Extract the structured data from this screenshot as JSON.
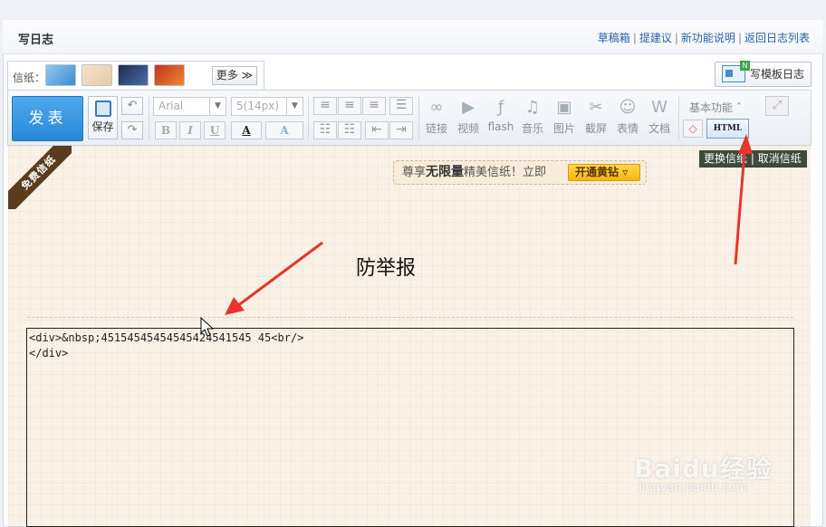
{
  "header": {
    "title": "写日志",
    "links": [
      "草稿箱",
      "提建议",
      "新功能说明",
      "返回日志列表"
    ],
    "separator": "|"
  },
  "stationery": {
    "label": "信纸：",
    "thumb_icons": [
      "lion-stationery-icon",
      "fairy-girl-stationery-icon",
      "boy-stationery-icon",
      "red-hair-girl-stationery-icon"
    ],
    "more_label": "更多",
    "more_chevron": "≫"
  },
  "template": {
    "label": "写模板日志"
  },
  "toolbar": {
    "publish_label": "发表",
    "save_label": "保存",
    "undo_glyph": "↶",
    "redo_glyph": "↷",
    "font_family": "Arial",
    "font_size": "5(14px)",
    "bold": "B",
    "italic": "I",
    "underline": "U",
    "font_color": "A",
    "highlight": "A",
    "media": [
      {
        "label": "链接",
        "glyph": "∞"
      },
      {
        "label": "视频",
        "glyph": "▶"
      },
      {
        "label": "flash",
        "glyph": "ƒ"
      },
      {
        "label": "音乐",
        "glyph": "♫"
      },
      {
        "label": "图片",
        "glyph": "▣"
      },
      {
        "label": "截屏",
        "glyph": "✂"
      },
      {
        "label": "表情",
        "glyph": "☺"
      },
      {
        "label": "文档",
        "glyph": "W"
      }
    ],
    "basic_label": "基本功能",
    "basic_chevron": "ˆ",
    "html_label": "HTML",
    "eraser_glyph": "◇",
    "expand_glyph": "⤢"
  },
  "editor": {
    "banner_text": "免费信纸",
    "change_stationery": "更换信纸",
    "cancel_stationery": "取消信纸",
    "change_sep": "|",
    "promo_prefix": "尊享",
    "promo_bold": "无限量",
    "promo_suffix": "精美信纸！立即",
    "promo_button": "开通黄钻",
    "annotation": "防举报",
    "code_line1": "<div>&nbsp;45154545454545424541545 45<br/>",
    "code_line2": "</div>"
  },
  "watermark": {
    "brand": "Baidu经验",
    "url": "jingyan.baidu.com"
  }
}
